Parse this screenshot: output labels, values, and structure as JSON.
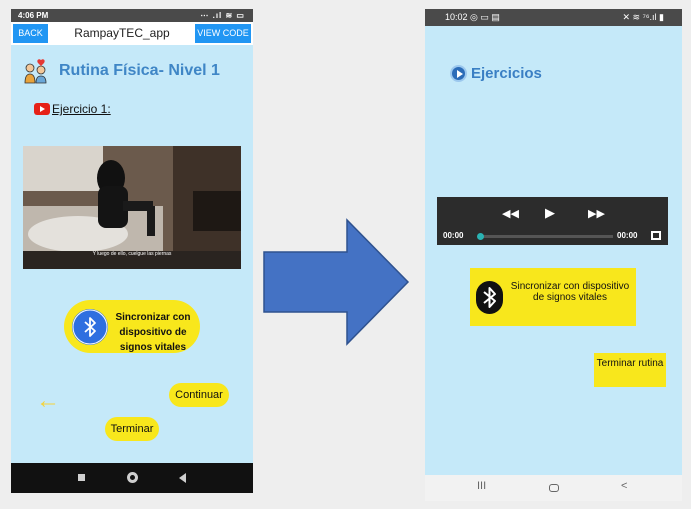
{
  "left_phone": {
    "status": {
      "time": "4:06 PM",
      "icons": "⋯ .ıl ≋ ▭"
    },
    "appbar": {
      "back_label": "BACK",
      "title": "RampayTEC_app",
      "view_code_label": "VIEW CODE"
    },
    "page_title": "Rutina Física- Nivel 1",
    "exercise_label": "Ejercicio 1:",
    "video_subtitle": "Y luego de ello, cuelgue las piernas",
    "sync_label": "Sincronizar con dispositivo de signos vitales",
    "continue_label": "Continuar",
    "finish_label": "Terminar",
    "icons": {
      "back_arrow": "arrow-left-icon",
      "bluetooth": "bluetooth-icon",
      "fitness": "fitness-couple-icon",
      "youtube": "youtube-icon"
    }
  },
  "right_phone": {
    "status": {
      "time": "10:02 ◎ ▭ ▤",
      "icons": "✕ ≋ ⁷⁶.ıl ▮"
    },
    "page_title": "Ejercicios",
    "player": {
      "current_time": "00:00",
      "total_time": "00:00",
      "progress": 0
    },
    "sync_label": "Sincronizar con dispositivo de signos vitales",
    "finish_label": "Terminar rutina",
    "nav": {
      "recents": "III",
      "back": "<"
    }
  },
  "colors": {
    "screen_bg": "#c5e9f9",
    "accent_yellow": "#f8e71c",
    "button_blue": "#2196f3",
    "title_blue": "#3f86c6",
    "arrow_blue": "#4472c4"
  }
}
